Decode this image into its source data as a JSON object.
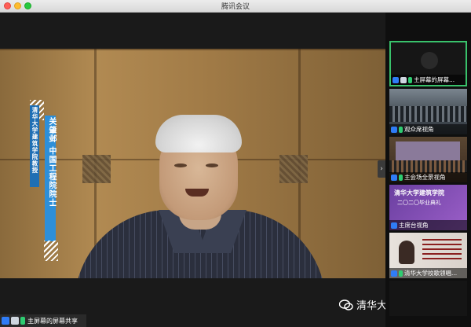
{
  "window": {
    "title": "腾讯会议"
  },
  "video": {
    "banner_name": "关肇邺 中国工程院院士",
    "banner_affiliation": "清华大学建筑学院教授"
  },
  "status": {
    "label": "主屏幕的屏幕共享"
  },
  "watermark": {
    "text": "清华大学建筑学院"
  },
  "sidebar": {
    "collapse_glyph": "›",
    "thumbs": [
      {
        "label": "主屏幕的屏幕...",
        "active": true
      },
      {
        "label": "观众席视角"
      },
      {
        "label": "主会场全景视角"
      },
      {
        "label": "主席台视角",
        "poster_title": "清华大学建筑学院",
        "poster_sub": "二〇二〇毕业典礼"
      },
      {
        "label": "清华大学校歌领唱..."
      },
      {
        "label": ""
      }
    ]
  },
  "colors": {
    "active_border": "#39c26b",
    "user_icon": "#2f7cf6",
    "mic_icon": "#2ecc71"
  }
}
